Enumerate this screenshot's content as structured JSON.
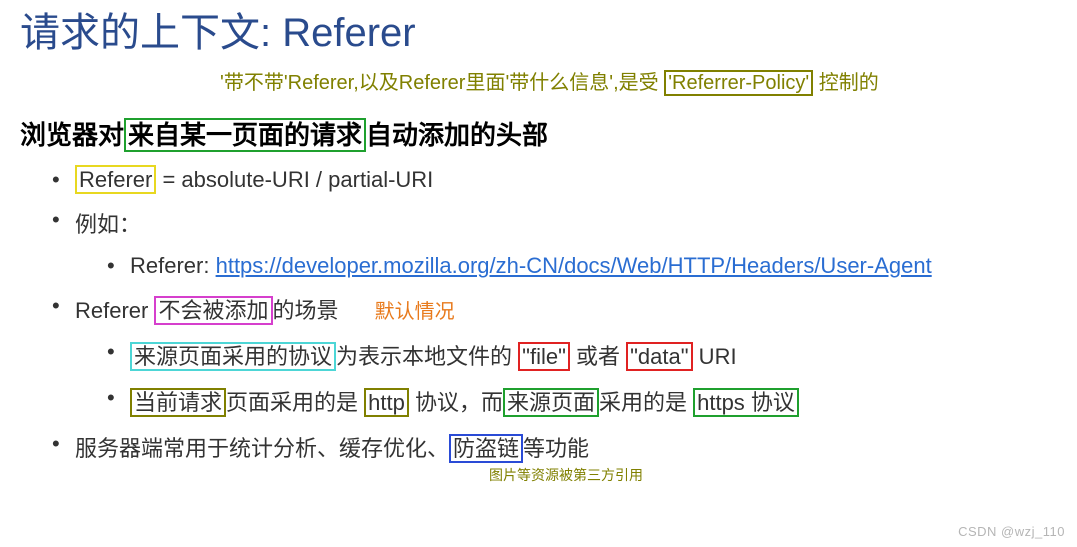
{
  "title": "请求的上下文: Referer",
  "subtitle": {
    "s1": "'带不带'Referer,以及Referer里面'带什么信息',是受 ",
    "s2": "'Referrer-Policy'",
    "s3": " 控制的"
  },
  "heading": {
    "h1": "浏览器对",
    "h2": "来自某一页面的请求",
    "h3": "自动添加的头部"
  },
  "item_referer_def": {
    "label": "Referer",
    "rest": " = absolute-URI / partial-URI"
  },
  "item_example_label": "例如：",
  "item_example_detail": {
    "prefix": "Referer: ",
    "url": "https://developer.mozilla.org/zh-CN/docs/Web/HTTP/Headers/User-Agent"
  },
  "item_not_added": {
    "p1": "Referer ",
    "p2": "不会被添加",
    "p3": "的场景",
    "note": "默认情况"
  },
  "not_added_case1": {
    "c1": "来源页面采用的协议",
    "c2": "为表示本地文件的 ",
    "c3": "\"file\"",
    "c4": " 或者 ",
    "c5": "\"data\"",
    "c6": " URI"
  },
  "not_added_case2": {
    "c1": "当前请求",
    "c2": "页面采用的是 ",
    "c3": "http",
    "c4": " 协议，而",
    "c5": "来源页面",
    "c6": "采用的是 ",
    "c7": "https 协议"
  },
  "item_server": {
    "s1": "服务器端常用于统计分析、缓存优化、",
    "s2": "防盗链",
    "s3": "等功能"
  },
  "footnote": "图片等资源被第三方引用",
  "watermark": "CSDN @wzj_110"
}
